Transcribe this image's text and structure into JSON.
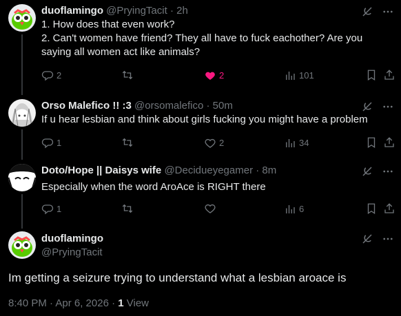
{
  "tweets": [
    {
      "name": "duoflamingo",
      "handle": "@PryingTacit",
      "time": "2h",
      "lines": [
        "1. How does that even work?",
        "2. Can't women have friend? They all have to fuck eachother? Are you",
        "saying all women act like animals?"
      ],
      "replies": "2",
      "likes": "2",
      "views": "101"
    },
    {
      "name": "Orso Malefico !! :3",
      "handle": "@orsomalefico",
      "time": "50m",
      "lines": [
        "If u hear lesbian and think about girls fucking you might have a problem"
      ],
      "replies": "1",
      "likes": "2",
      "views": "34"
    },
    {
      "name": "Doto/Hope || Daisys wife",
      "handle": "@Decidueyegamer",
      "time": "8m",
      "lines": [
        "Especially when the word AroAce is RIGHT there"
      ],
      "replies": "1",
      "likes": "",
      "views": "6"
    }
  ],
  "main": {
    "name": "duoflamingo",
    "handle": "@PryingTacit",
    "text": "Im getting a seizure trying to understand what a lesbian aroace is",
    "timestamp": "8:40 PM · Apr 6, 2026 · ",
    "views_count": "1",
    "views_label": " View"
  },
  "colors": {
    "background": "#000000",
    "text": "#e7e9ea",
    "muted": "#71767b",
    "like": "#f91880"
  },
  "icons": [
    "grok-icon",
    "more-icon",
    "reply-icon",
    "retweet-icon",
    "like-icon",
    "views-icon",
    "bookmark-icon",
    "share-icon"
  ]
}
